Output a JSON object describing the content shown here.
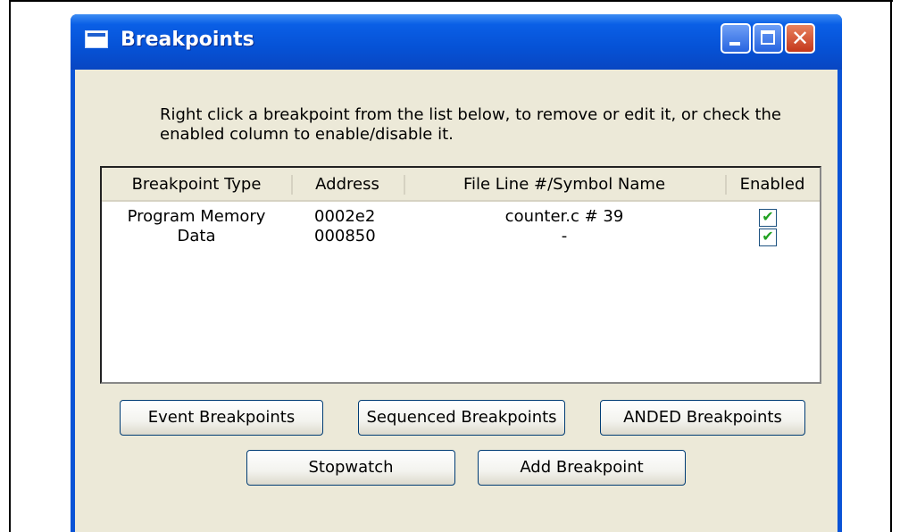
{
  "window": {
    "title": "Breakpoints"
  },
  "titlebar_buttons": {
    "close_glyph": "✕"
  },
  "instructions": "Right click a breakpoint from the list below, to remove or edit it, or check the enabled column to enable/disable it.",
  "table": {
    "columns": [
      "Breakpoint Type",
      "Address",
      "File Line #/Symbol Name",
      "Enabled"
    ],
    "rows": [
      {
        "type": "Program Memory",
        "address": "0002e2",
        "file": "counter.c # 39",
        "enabled": true
      },
      {
        "type": "Data",
        "address": "000850",
        "file": "-",
        "enabled": true
      }
    ],
    "check_glyph": "✔"
  },
  "buttons": {
    "event": "Event Breakpoints",
    "sequenced": "Sequenced Breakpoints",
    "anded": "ANDED Breakpoints",
    "stopwatch": "Stopwatch",
    "add": "Add Breakpoint"
  }
}
